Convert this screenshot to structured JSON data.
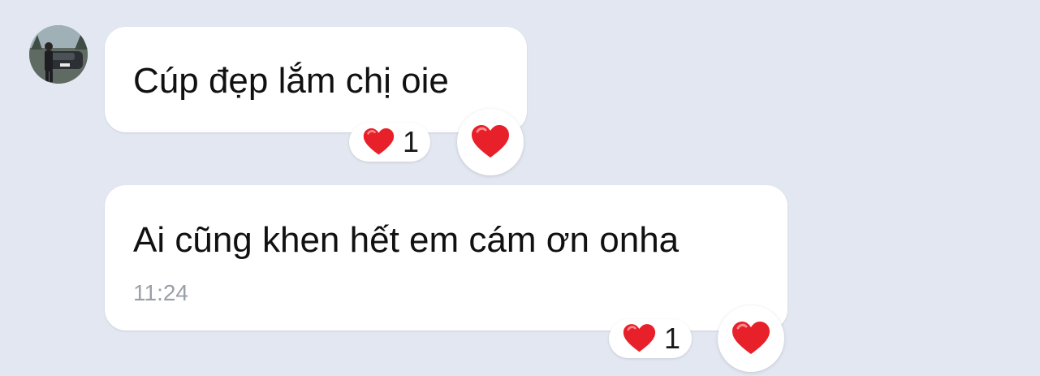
{
  "conversation": {
    "messages": [
      {
        "text": "Cúp đẹp lắm chị oie",
        "time": "",
        "reaction": {
          "icon": "heart-icon",
          "count": "1"
        }
      },
      {
        "text": "Ai cũng khen hết em cám ơn onha",
        "time": "11:24",
        "reaction": {
          "icon": "heart-icon",
          "count": "1"
        }
      }
    ]
  },
  "colors": {
    "background": "#e2e7f1",
    "bubble": "#ffffff",
    "heart": "#e8202a",
    "timestamp": "#9ba0a8"
  }
}
